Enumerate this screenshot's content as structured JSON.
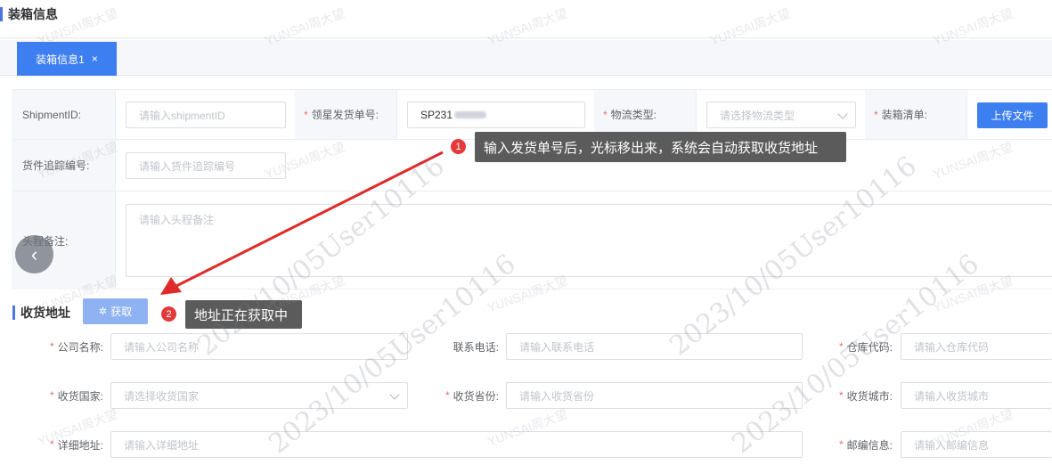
{
  "section1": {
    "title": "装箱信息"
  },
  "tabs": [
    {
      "label": "装箱信息1",
      "close": "×"
    }
  ],
  "form": {
    "shipment_id": {
      "label": "ShipmentID:",
      "placeholder": "请输入shipmentID"
    },
    "order_no": {
      "label": "领星发货单号:",
      "value": "SP231"
    },
    "logistics_type": {
      "label": "物流类型:",
      "placeholder": "请选择物流类型"
    },
    "packing_list": {
      "label": "装箱清单:",
      "button": "上传文件"
    },
    "tracking_no": {
      "label": "货件追踪编号:",
      "placeholder": "请输入货件追踪编号"
    },
    "remark": {
      "label": "头程备注:",
      "placeholder": "请输入头程备注"
    }
  },
  "callout1": {
    "num": "1",
    "text": "输入发货单号后，光标移出来，系统会自动获取收货地址"
  },
  "callout2": {
    "num": "2",
    "text": "地址正在获取中"
  },
  "section2": {
    "title": "收货地址",
    "get_button": "获取"
  },
  "address": {
    "company": {
      "label": "公司名称:",
      "placeholder": "请输入公司名称"
    },
    "phone": {
      "label": "联系电话:",
      "placeholder": "请输入联系电话"
    },
    "warehouse": {
      "label": "仓库代码:",
      "placeholder": "请输入仓库代码"
    },
    "country": {
      "label": "收货国家:",
      "placeholder": "请选择收货国家"
    },
    "province": {
      "label": "收货省份:",
      "placeholder": "请输入收货省份"
    },
    "city": {
      "label": "收货城市:",
      "placeholder": "请输入收货城市"
    },
    "detail": {
      "label": "详细地址:",
      "placeholder": "请输入详细地址"
    },
    "zip": {
      "label": "邮编信息:",
      "placeholder": "请输入邮编信息"
    }
  },
  "watermark": {
    "small": "YUNSAI周大望",
    "big": "2023/10/05User10116"
  },
  "colors": {
    "primary": "#3d7ef0",
    "required": "#f56c6c",
    "badge": "#e33b3b",
    "arrow": "#e02a2a"
  }
}
